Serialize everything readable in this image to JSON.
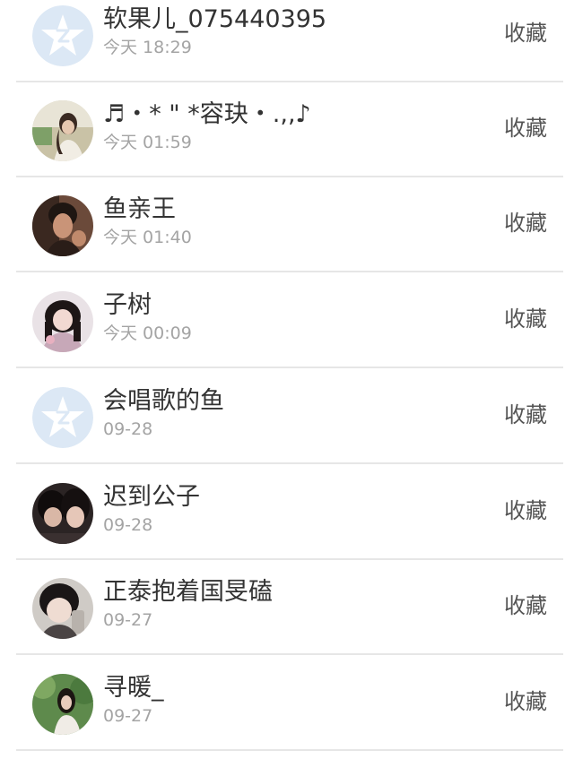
{
  "contacts": [
    {
      "name": "软果儿_075440395",
      "time": "今天 18:29",
      "action_label": "收藏",
      "avatar_icon": "default-qq-avatar-icon"
    },
    {
      "name": "♬・* \" *容玦・.,,♪",
      "time": "今天 01:59",
      "action_label": "收藏",
      "avatar_icon": "profile-photo"
    },
    {
      "name": "鱼亲王",
      "time": "今天 01:40",
      "action_label": "收藏",
      "avatar_icon": "profile-photo"
    },
    {
      "name": "子树",
      "time": "今天 00:09",
      "action_label": "收藏",
      "avatar_icon": "profile-photo"
    },
    {
      "name": "会唱歌的鱼",
      "time": "09-28",
      "action_label": "收藏",
      "avatar_icon": "default-qq-avatar-icon"
    },
    {
      "name": "迟到公子",
      "time": "09-28",
      "action_label": "收藏",
      "avatar_icon": "profile-photo"
    },
    {
      "name": "正泰抱着国旻磕",
      "time": "09-27",
      "action_label": "收藏",
      "avatar_icon": "profile-photo"
    },
    {
      "name": "寻暖_",
      "time": "09-27",
      "action_label": "收藏",
      "avatar_icon": "profile-photo"
    }
  ],
  "colors": {
    "name_text": "#333333",
    "time_text": "#a4a4a4",
    "action_text": "#555555",
    "divider": "#e6e6e6",
    "default_avatar_bg": "#dce8f5",
    "default_avatar_fg": "#ffffff"
  }
}
